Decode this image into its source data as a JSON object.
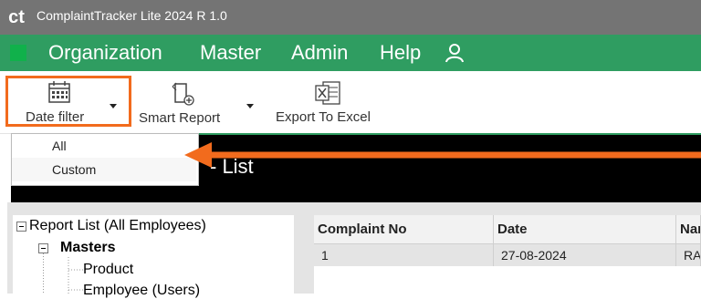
{
  "window": {
    "logo": "ct",
    "title": "ComplaintTracker Lite 2024 R 1.0"
  },
  "menu": {
    "items": [
      "Organization",
      "Master",
      "Admin",
      "Help"
    ]
  },
  "toolbar": {
    "date_filter_label": "Date filter",
    "smart_report_label": "Smart Report",
    "export_label": "Export To Excel"
  },
  "date_filter_menu": {
    "items": [
      "All",
      "Custom"
    ]
  },
  "report_header": {
    "title_fragment": "- List"
  },
  "tree": {
    "root": "Report List (All Employees)",
    "masters": "Masters",
    "product": "Product",
    "employee": "Employee (Users)"
  },
  "grid": {
    "columns": [
      "Complaint No",
      "Date",
      "Nar"
    ],
    "rows": [
      [
        "1",
        "27-08-2024",
        "RA"
      ]
    ]
  },
  "colors": {
    "accent": "#2f9d61",
    "highlight": "#f26b1d",
    "titlebar": "#747474"
  }
}
